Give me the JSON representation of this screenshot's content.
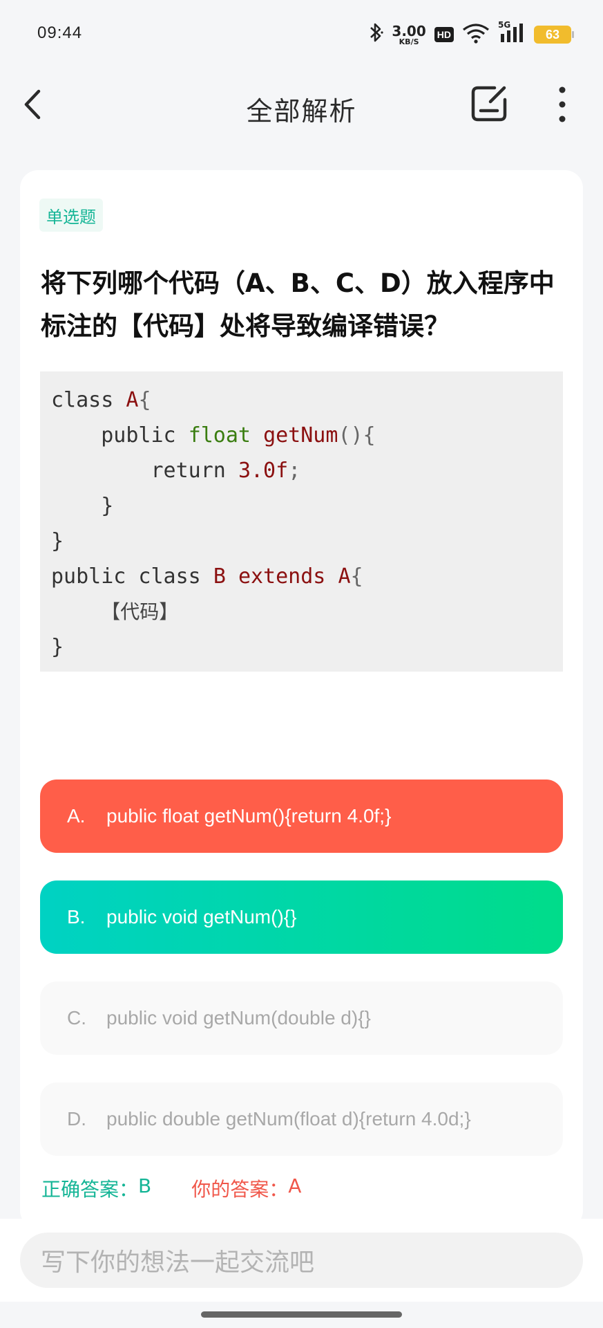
{
  "status_bar": {
    "time": "09:44",
    "net_speed_value": "3.00",
    "net_speed_unit": "KB/S",
    "hd_label": "HD",
    "network_label": "5G",
    "battery": "63"
  },
  "header": {
    "title": "全部解析"
  },
  "question": {
    "type_label": "单选题",
    "text": "将下列哪个代码（A、B、C、D）放入程序中标注的【代码】处将导致编译错误？",
    "code": {
      "l1_kw": "class ",
      "l1_cls": "A",
      "l1_p": "{",
      "l2_indent": "    ",
      "l2_kw": "public ",
      "l2_ty": "float ",
      "l2_fn": "getNum",
      "l2_p": "(){",
      "l3_indent": "        ",
      "l3_kw": "return ",
      "l3_num": "3.0f",
      "l3_p": ";",
      "l4": "    }",
      "l5": "}",
      "l6_kw": "public class ",
      "l6_cls": "B",
      "l6_sp": " ",
      "l6_ext": "extends",
      "l6_sp2": " ",
      "l6_cls2": "A",
      "l6_p": "{",
      "l7_indent": "    ",
      "l7_placeholder": "【代码】",
      "l8": "}"
    }
  },
  "options": [
    {
      "letter": "A.",
      "text": "public float getNum(){return 4.0f;}",
      "state": "wrong-selected"
    },
    {
      "letter": "B.",
      "text": "public void getNum(){}",
      "state": "correct"
    },
    {
      "letter": "C.",
      "text": "public void getNum(double d){}",
      "state": "normal"
    },
    {
      "letter": "D.",
      "text": "public double getNum(float d){return 4.0d;}",
      "state": "normal"
    }
  ],
  "answers": {
    "correct_label": "正确答案：",
    "correct_value": "B",
    "yours_label": "你的答案：",
    "yours_value": "A"
  },
  "comment": {
    "placeholder": "写下你的想法一起交流吧"
  },
  "colors": {
    "accent_green": "#15b596",
    "wrong_red": "#ff5e49",
    "correct_gradient_start": "#00d2c3",
    "correct_gradient_end": "#00dc8a",
    "battery_yellow": "#f1bc2d"
  },
  "icons": [
    "bluetooth-icon",
    "wifi-icon",
    "signal-icon",
    "battery-icon",
    "back-arrow-icon",
    "edit-note-icon",
    "more-vertical-icon"
  ]
}
